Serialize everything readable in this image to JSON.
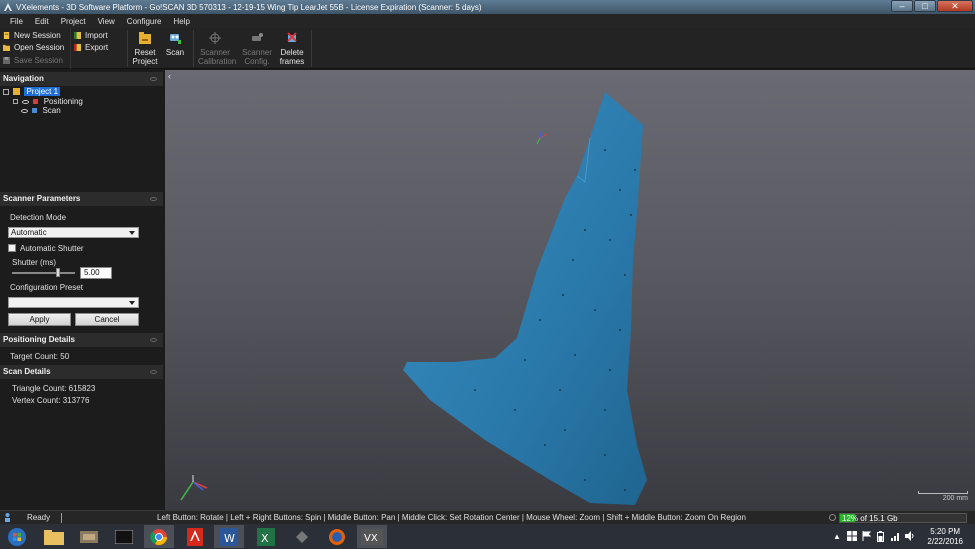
{
  "window": {
    "title": "VXelements - 3D Software Platform - Go!SCAN 3D 570313 - 12-19-15 Wing Tip LearJet 55B - License Expiration (Scanner: 5 days)",
    "controls": [
      "–",
      "□",
      "✕"
    ]
  },
  "menu": [
    "File",
    "Edit",
    "Project",
    "View",
    "Configure",
    "Help"
  ],
  "toolbar": {
    "new_session": "New Session",
    "open_session": "Open Session",
    "save_session": "Save Session",
    "import": "Import",
    "export": "Export",
    "reset_project": "Reset Project",
    "scan": "Scan",
    "scanner_calibration": "Scanner Calibration",
    "scanner_config": "Scanner Config.",
    "delete_frames": "Delete frames"
  },
  "navigation": {
    "header": "Navigation",
    "project": "Project 1",
    "positioning": "Positioning",
    "scan": "Scan"
  },
  "scanner_parameters": {
    "header": "Scanner Parameters",
    "detection_mode_label": "Detection Mode",
    "detection_mode_value": "Automatic",
    "automatic_shutter_label": "Automatic Shutter",
    "automatic_shutter_checked": false,
    "shutter_label": "Shutter (ms)",
    "shutter_value": "5.00",
    "config_preset_label": "Configuration Preset",
    "config_preset_value": "",
    "apply": "Apply",
    "cancel": "Cancel"
  },
  "positioning_details": {
    "header": "Positioning Details",
    "target_count": "Target Count: 50"
  },
  "scan_details": {
    "header": "Scan Details",
    "triangle_count": "Triangle Count: 615823",
    "vertex_count": "Vertex Count: 313776"
  },
  "viewport": {
    "scale_label": "200 mm",
    "mesh_color": "#2e7fb0"
  },
  "statusbar": {
    "state": "Ready",
    "hints": "Left Button: Rotate  |  Left + Right Buttons: Spin  |  Middle Button: Pan  |  Middle Click: Set Rotation Center  |  Mouse Wheel: Zoom  |  Shift + Middle Button: Zoom On Region",
    "memory_percent": "12%",
    "memory_total": "of 15.1 Gb",
    "memory_fraction": 0.12
  },
  "taskbar": {
    "time": "5:20 PM",
    "date": "2/22/2016"
  },
  "colors": {
    "selection": "#1f6fd6",
    "memory": "#22b422",
    "mesh": "#2e7fb0"
  }
}
